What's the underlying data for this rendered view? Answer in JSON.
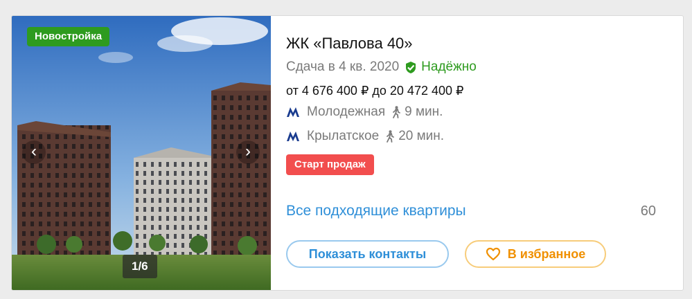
{
  "listing": {
    "badge_new": "Новостройка",
    "photo_counter": "1/6",
    "title": "ЖК «Павлова 40»",
    "completion": "Сдача в 4 кв. 2020",
    "reliability": "Надёжно",
    "price": "от 4 676 400 ₽ до 20 472 400 ₽",
    "metro": [
      {
        "station": "Молодежная",
        "walk": "9 мин.",
        "icon": "metro-icon"
      },
      {
        "station": "Крылатское",
        "walk": "20 мин.",
        "icon": "metro-icon"
      }
    ],
    "sale_badge": "Старт продаж",
    "all_flats_link": "Все подходящие квартиры",
    "flats_count": "60",
    "buttons": {
      "show_contacts": "Показать контакты",
      "favorite": "В избранное"
    }
  },
  "icons": {
    "prev": "chevron-left-icon",
    "next": "chevron-right-icon",
    "reliable": "shield-check-icon",
    "walk": "walking-person-icon",
    "favorite": "heart-icon"
  },
  "colors": {
    "green": "#2e9b1f",
    "blue": "#2f8fd8",
    "metro_blue": "#1a3c8f",
    "sale_red": "#f24e4e",
    "orange": "#f09000"
  }
}
